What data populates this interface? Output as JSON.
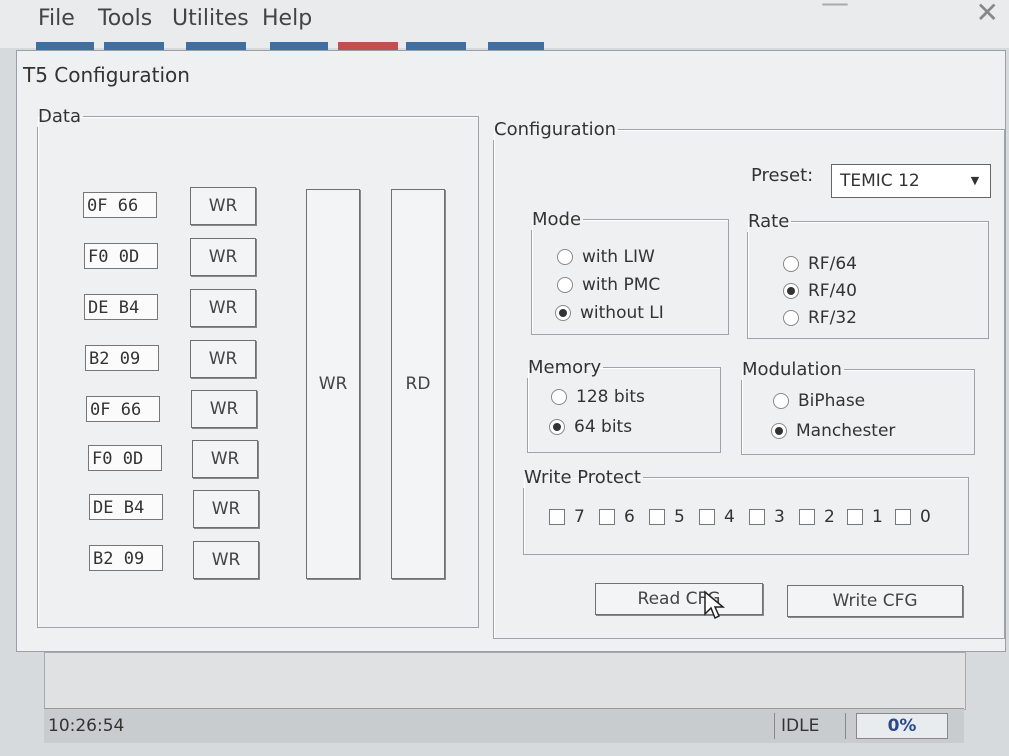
{
  "menu": [
    "File",
    "Tools",
    "Utilites",
    "Help"
  ],
  "window": {
    "close_symbol": "✕",
    "min_symbol": "—"
  },
  "dialog": {
    "title": "T5 Configuration"
  },
  "data_panel": {
    "label": "Data",
    "rows": [
      {
        "value": "0F 66",
        "button": "WR"
      },
      {
        "value": "F0 0D",
        "button": "WR"
      },
      {
        "value": "DE B4",
        "button": "WR"
      },
      {
        "value": "B2 09",
        "button": "WR"
      },
      {
        "value": "0F 66",
        "button": "WR"
      },
      {
        "value": "F0 0D",
        "button": "WR"
      },
      {
        "value": "DE B4",
        "button": "WR"
      },
      {
        "value": "B2 09",
        "button": "WR"
      }
    ],
    "wr_all_label": "WR",
    "rd_all_label": "RD"
  },
  "config_panel": {
    "label": "Configuration",
    "preset_label": "Preset:",
    "preset_value": "TEMIC 12",
    "mode": {
      "label": "Mode",
      "options": [
        "with LIW",
        "with PMC",
        "without LI"
      ],
      "selected_index": 2
    },
    "rate": {
      "label": "Rate",
      "options": [
        "RF/64",
        "RF/40",
        "RF/32"
      ],
      "selected_index": 1
    },
    "memory": {
      "label": "Memory",
      "options": [
        "128 bits",
        "64 bits"
      ],
      "selected_index": 1
    },
    "modulation": {
      "label": "Modulation",
      "options": [
        "BiPhase",
        "Manchester"
      ],
      "selected_index": 1
    },
    "write_protect": {
      "label": "Write Protect",
      "bits": [
        "7",
        "6",
        "5",
        "4",
        "3",
        "2",
        "1",
        "0"
      ]
    },
    "read_button": "Read CFG",
    "write_button": "Write CFG"
  },
  "status": {
    "time": "10:26:54",
    "state": "IDLE",
    "progress": "0%"
  },
  "colors": {
    "tab_strip": [
      "#3f6fa0",
      "#3f6fa0",
      "#3f6fa0",
      "#3f6fa0",
      "#c0504d",
      "#3f6fa0",
      "#3f6fa0"
    ]
  }
}
